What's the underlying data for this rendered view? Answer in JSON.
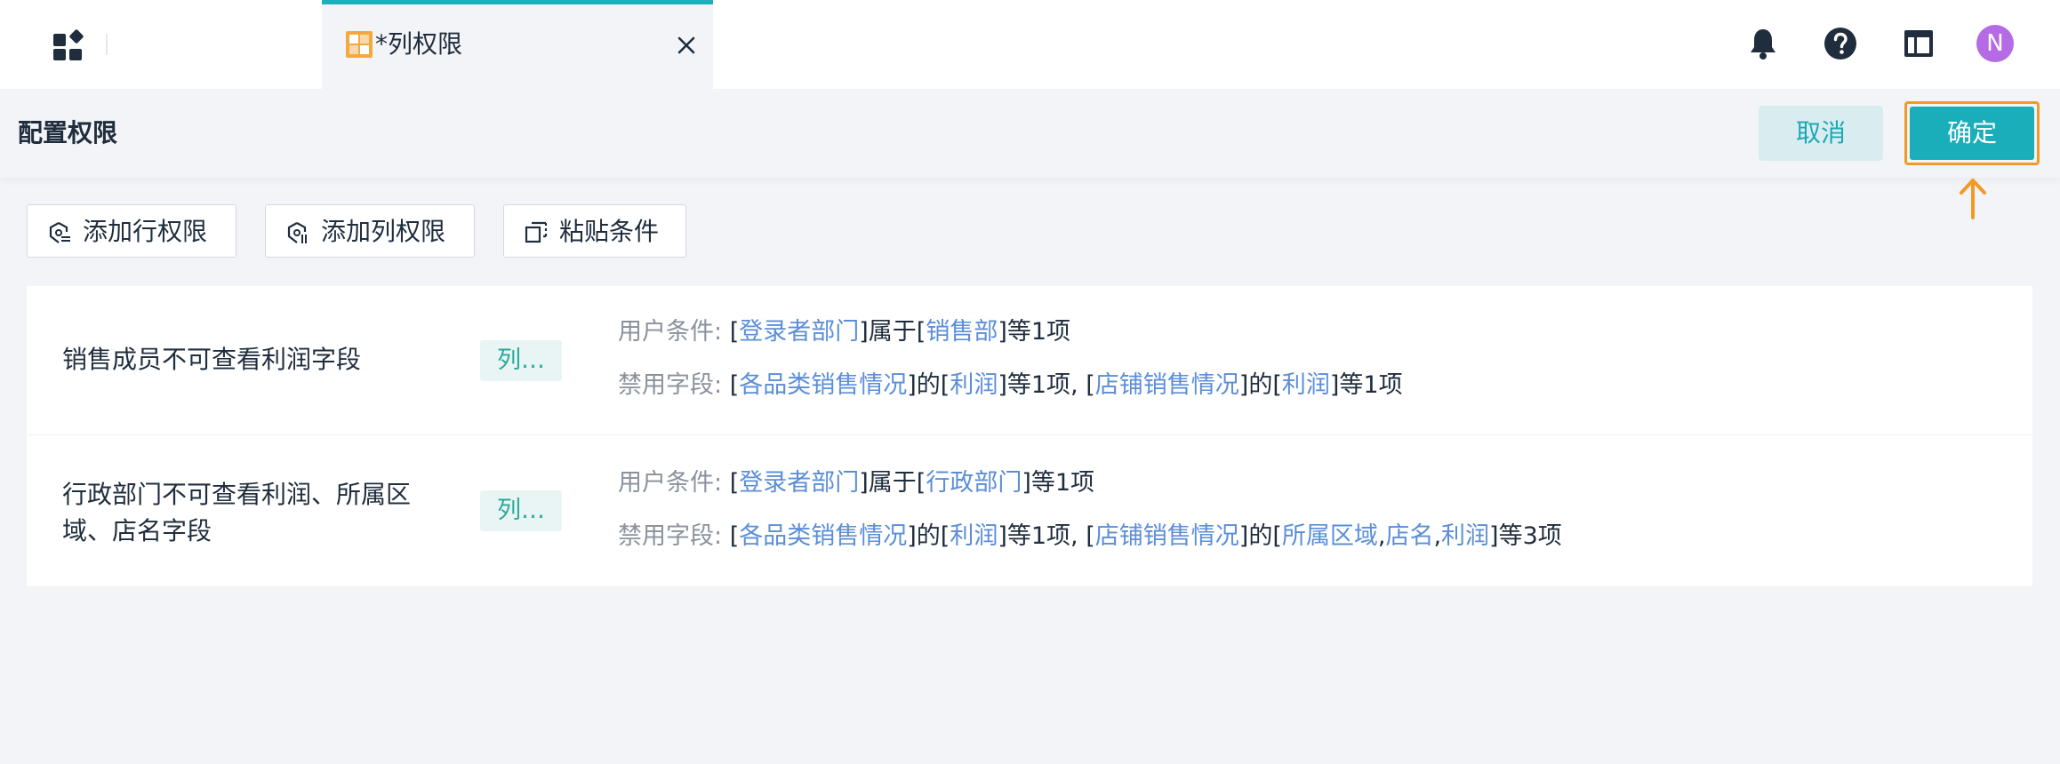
{
  "topbar": {
    "tab_label": "*列权限",
    "avatar_letter": "N"
  },
  "header": {
    "title": "配置权限",
    "cancel_label": "取消",
    "confirm_label": "确定"
  },
  "toolbar": {
    "add_row_label": "添加行权限",
    "add_col_label": "添加列权限",
    "paste_label": "粘贴条件"
  },
  "rules": [
    {
      "name": "销售成员不可查看利润字段",
      "tag": "列…",
      "user_cond_prefix": "用户条件: ",
      "user_cond_field": "登录者部门",
      "user_cond_op": "属于",
      "user_cond_value": "销售部",
      "user_cond_suffix": "等1项",
      "forbid_prefix": "禁用字段: ",
      "forbid_table1": "各品类销售情况",
      "forbid_of1": "的",
      "forbid_fields1": "利润",
      "forbid_count1": "等1项, ",
      "forbid_table2": "店铺销售情况",
      "forbid_of2": "的",
      "forbid_fields2": "利润",
      "forbid_count2": "等1项"
    },
    {
      "name": "行政部门不可查看利润、所属区域、店名字段",
      "tag": "列…",
      "user_cond_prefix": "用户条件: ",
      "user_cond_field": "登录者部门",
      "user_cond_op": "属于",
      "user_cond_value": "行政部门",
      "user_cond_suffix": "等1项",
      "forbid_prefix": "禁用字段: ",
      "forbid_table1": "各品类销售情况",
      "forbid_of1": "的",
      "forbid_fields1": "利润",
      "forbid_count1": "等1项, ",
      "forbid_table2": "店铺销售情况",
      "forbid_of2": "的",
      "forbid_field2a": "所属区域",
      "forbid_field2b": "店名",
      "forbid_field2c": "利润",
      "forbid_count2": "等3项"
    }
  ],
  "colors": {
    "accent": "#1aaebb",
    "highlight": "#f29a27",
    "link": "#5b8ed8",
    "avatar": "#b56ae6"
  }
}
